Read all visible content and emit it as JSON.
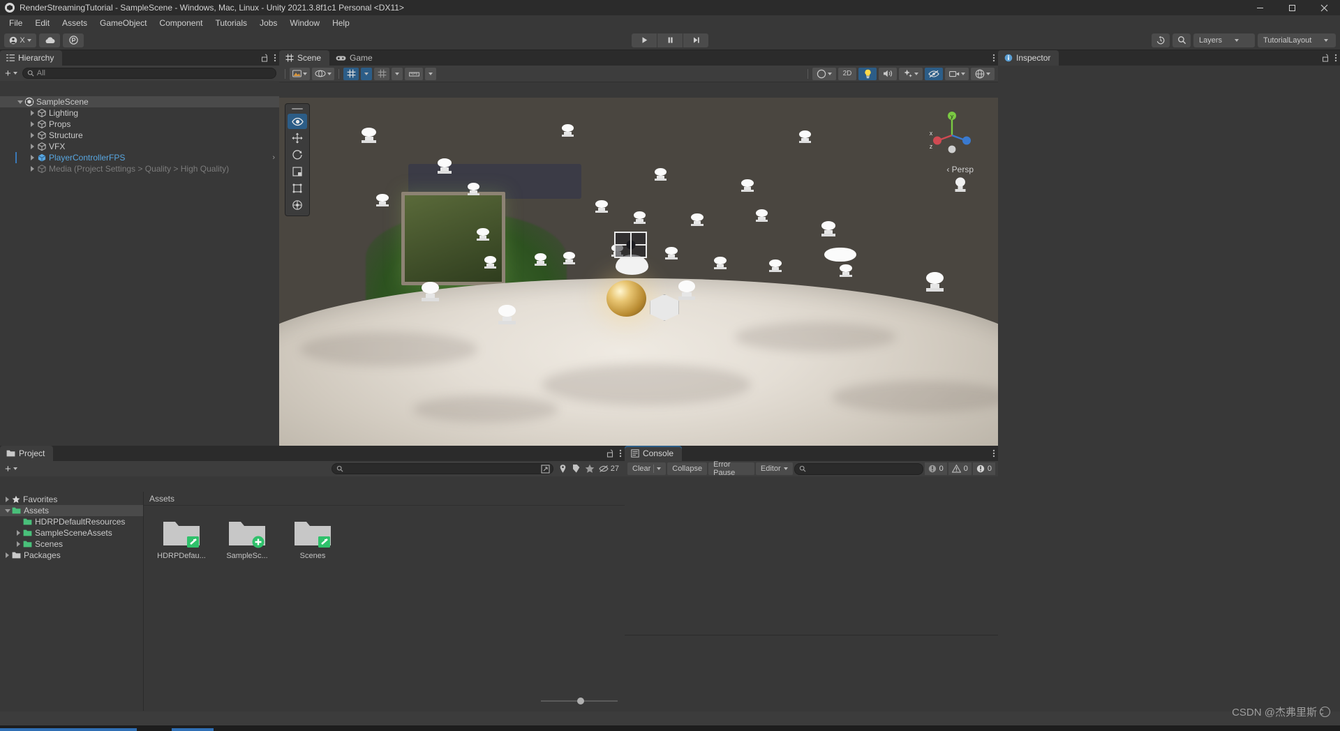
{
  "window": {
    "title": "RenderStreamingTutorial - SampleScene - Windows, Mac, Linux - Unity 2021.3.8f1c1 Personal <DX11>",
    "minimize": "─",
    "maximize": "⬜",
    "close": "✕",
    "logo_icon": "unity-logo-icon"
  },
  "menu": {
    "items": [
      {
        "label": "File"
      },
      {
        "label": "Edit"
      },
      {
        "label": "Assets"
      },
      {
        "label": "GameObject"
      },
      {
        "label": "Component"
      },
      {
        "label": "Tutorials"
      },
      {
        "label": "Jobs"
      },
      {
        "label": "Window"
      },
      {
        "label": "Help"
      }
    ]
  },
  "toolbar": {
    "account_label": "X",
    "account_icon": "account-icon",
    "cloud_icon": "cloud-icon",
    "collab_icon": "services-icon",
    "play_icon": "▶",
    "pause_icon": "⏸",
    "step_icon": "⏭",
    "undo_history_icon": "undo-history-icon",
    "search_icon": "search-icon",
    "layers_label": "Layers",
    "layout_label": "TutorialLayout"
  },
  "hierarchy": {
    "tab_label": "Hierarchy",
    "tab_icon": "hierarchy-icon",
    "lock_icon": "lock-open-icon",
    "menu_icon": "kebab-menu-icon",
    "add_label": "+",
    "search_placeholder": "All",
    "rows": [
      {
        "label": "SampleScene",
        "depth": 0,
        "icon": "unity-scene-icon",
        "expanded": true,
        "selected": true,
        "dim": false,
        "highlight": false
      },
      {
        "label": "Lighting",
        "depth": 1,
        "icon": "gameobject-icon",
        "expanded": false,
        "selected": false,
        "dim": false,
        "highlight": false
      },
      {
        "label": "Props",
        "depth": 1,
        "icon": "gameobject-icon",
        "expanded": false,
        "selected": false,
        "dim": false,
        "highlight": false
      },
      {
        "label": "Structure",
        "depth": 1,
        "icon": "gameobject-icon",
        "expanded": false,
        "selected": false,
        "dim": false,
        "highlight": false
      },
      {
        "label": "VFX",
        "depth": 1,
        "icon": "gameobject-icon",
        "expanded": false,
        "selected": false,
        "dim": false,
        "highlight": false
      },
      {
        "label": "PlayerControllerFPS",
        "depth": 1,
        "icon": "prefab-icon",
        "expanded": false,
        "selected": false,
        "dim": false,
        "highlight": true
      },
      {
        "label": "Media (Project Settings > Quality > High Quality)",
        "depth": 1,
        "icon": "gameobject-icon",
        "expanded": false,
        "selected": false,
        "dim": true,
        "highlight": false
      }
    ]
  },
  "scene": {
    "tabs": [
      {
        "label": "Scene",
        "icon": "scene-grid-icon",
        "active": true
      },
      {
        "label": "Game",
        "icon": "gamepad-icon",
        "active": false
      }
    ],
    "menu_icon": "kebab-menu-icon",
    "toolbar": {
      "draw_mode_label": "Shaded",
      "draw_mode_icon": "shading-mode-icon",
      "2d_label": "2D",
      "lighting_icon": "light-bulb-icon",
      "audio_icon": "audio-icon",
      "fx_icon": "effects-icon",
      "hidden_icon": "hidden-objects-icon",
      "camera_icon": "scene-camera-icon",
      "gizmos_icon": "gizmos-icon",
      "gizmo_dropdown_icon": "chevron-down-icon",
      "grid_icon": "grid-icon",
      "snap_icon": "snap-increment-icon",
      "component_tools_icon": "component-tools-icon",
      "view_options_icon": "view-options-icon"
    },
    "tools_overlay": {
      "items": [
        {
          "name": "view-tool",
          "icon": "eye-icon",
          "active": true
        },
        {
          "name": "move-tool",
          "icon": "move-icon",
          "active": false
        },
        {
          "name": "rotate-tool",
          "icon": "rotate-icon",
          "active": false
        },
        {
          "name": "scale-tool",
          "icon": "scale-icon",
          "active": false
        },
        {
          "name": "rect-tool",
          "icon": "rect-transform-icon",
          "active": false
        },
        {
          "name": "transform-tool",
          "icon": "transform-icon",
          "active": false
        }
      ]
    },
    "gizmo": {
      "x_label": "x",
      "y_label": "y",
      "z_label": "z",
      "persp_label": "‹ Persp",
      "camera_preview_icon": "camera-preview-icon"
    }
  },
  "inspector": {
    "tab_label": "Inspector",
    "tab_icon": "inspector-icon",
    "lock_icon": "lock-open-icon",
    "menu_icon": "kebab-menu-icon"
  },
  "project": {
    "tab_label": "Project",
    "tab_icon": "project-folder-icon",
    "lock_icon": "lock-open-icon",
    "menu_icon": "kebab-menu-icon",
    "add_label": "+",
    "search_placeholder": "",
    "search_icon": "search-icon",
    "save_search_icon": "save-search-icon",
    "filter_type_icon": "filter-by-type-icon",
    "filter_label_icon": "filter-by-label-icon",
    "favorite_icon": "star-icon",
    "hidden_packages_icon": "hidden-packages-icon",
    "hidden_packages_count": "27",
    "tree": [
      {
        "label": "Favorites",
        "depth": 0,
        "icon": "star-icon",
        "expandable": true,
        "selected": false
      },
      {
        "label": "Assets",
        "depth": 0,
        "icon": "folder-icon",
        "expandable": true,
        "expanded": true,
        "selected": true
      },
      {
        "label": "HDRPDefaultResources",
        "depth": 1,
        "icon": "folder-icon",
        "expandable": false,
        "selected": false
      },
      {
        "label": "SampleSceneAssets",
        "depth": 1,
        "icon": "folder-icon",
        "expandable": true,
        "selected": false
      },
      {
        "label": "Scenes",
        "depth": 1,
        "icon": "folder-icon",
        "expandable": true,
        "selected": false
      },
      {
        "label": "Packages",
        "depth": 0,
        "icon": "folder-icon",
        "expandable": true,
        "selected": false
      }
    ],
    "breadcrumb": "Assets",
    "assets": [
      {
        "label": "HDRPDefau...",
        "icon": "folder-icon",
        "badge": "vcs-edit-badge"
      },
      {
        "label": "SampleSc...",
        "icon": "folder-icon",
        "badge": "vcs-add-badge"
      },
      {
        "label": "Scenes",
        "icon": "folder-icon",
        "badge": "vcs-edit-badge"
      }
    ],
    "zoom_slider_value": "45"
  },
  "console": {
    "tab_label": "Console",
    "tab_icon": "console-icon",
    "menu_icon": "kebab-menu-icon",
    "clear_label": "Clear",
    "collapse_label": "Collapse",
    "error_pause_label": "Error Pause",
    "editor_label": "Editor",
    "search_placeholder": "",
    "search_icon": "search-icon",
    "log_count": "0",
    "warning_count": "0",
    "error_count": "0",
    "log_icon": "info-icon",
    "warning_icon": "warning-icon",
    "error_icon": "error-icon"
  },
  "watermark": {
    "text": "CSDN @杰弗里斯",
    "badge_icon": "csdn-badge-icon"
  },
  "colors": {
    "accent_blue": "#2c5d87",
    "selection": "#4a4a4a",
    "prefab_blue": "#58a6e0",
    "panel_bg": "#383838",
    "tab_bg": "#2b2b2b",
    "toolbar_bg": "#3d3d3d",
    "vcs_green": "#3ac07a",
    "axis_x": "#d04a52",
    "axis_y": "#7ac943",
    "axis_z": "#3a7ad0"
  }
}
